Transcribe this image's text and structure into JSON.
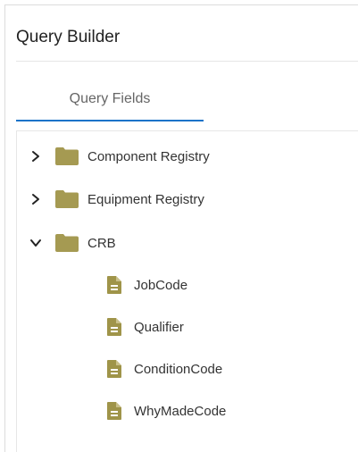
{
  "panel": {
    "title": "Query Builder"
  },
  "tabs": [
    {
      "label": "Query Fields",
      "active": true
    }
  ],
  "tree": {
    "folders": [
      {
        "label": "Component Registry",
        "expanded": false,
        "icon": "folder-icon"
      },
      {
        "label": "Equipment Registry",
        "expanded": false,
        "icon": "folder-icon"
      },
      {
        "label": "CRB",
        "expanded": true,
        "icon": "folder-icon",
        "children": [
          {
            "label": "JobCode",
            "icon": "file-icon"
          },
          {
            "label": "Qualifier",
            "icon": "file-icon"
          },
          {
            "label": "ConditionCode",
            "icon": "file-icon"
          },
          {
            "label": "WhyMadeCode",
            "icon": "file-icon"
          }
        ]
      }
    ]
  },
  "colors": {
    "accent": "#1a73c9",
    "folder": "#a59a52",
    "file": "#9f9449",
    "text": "#333333"
  }
}
